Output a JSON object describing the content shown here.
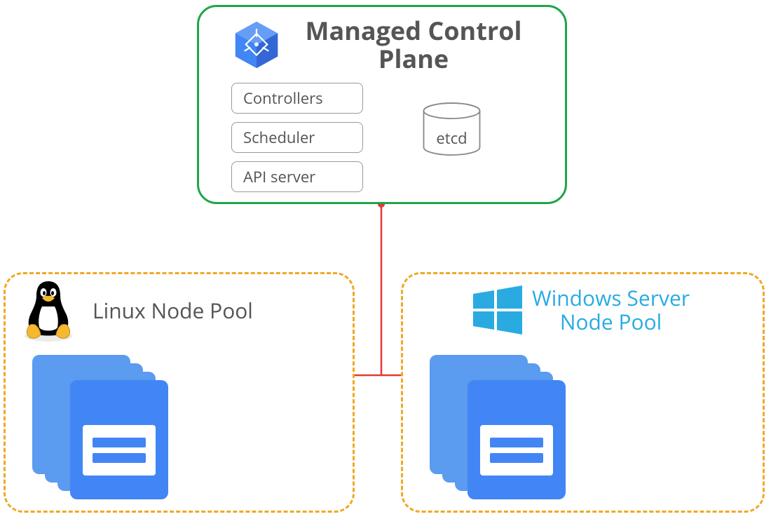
{
  "control_plane": {
    "title": "Managed Control Plane",
    "components": {
      "controllers": "Controllers",
      "scheduler": "Scheduler",
      "api_server": "API server"
    },
    "etcd_label": "etcd"
  },
  "node_pools": {
    "linux": {
      "title": "Linux Node Pool"
    },
    "windows": {
      "title": "Windows Server Node Pool"
    }
  },
  "colors": {
    "green_border": "#1ea548",
    "orange_dash": "#f0a826",
    "connector_red": "#e53935",
    "gke_blue": "#4285f4",
    "windows_blue": "#29abe2",
    "text_gray": "#555555"
  }
}
